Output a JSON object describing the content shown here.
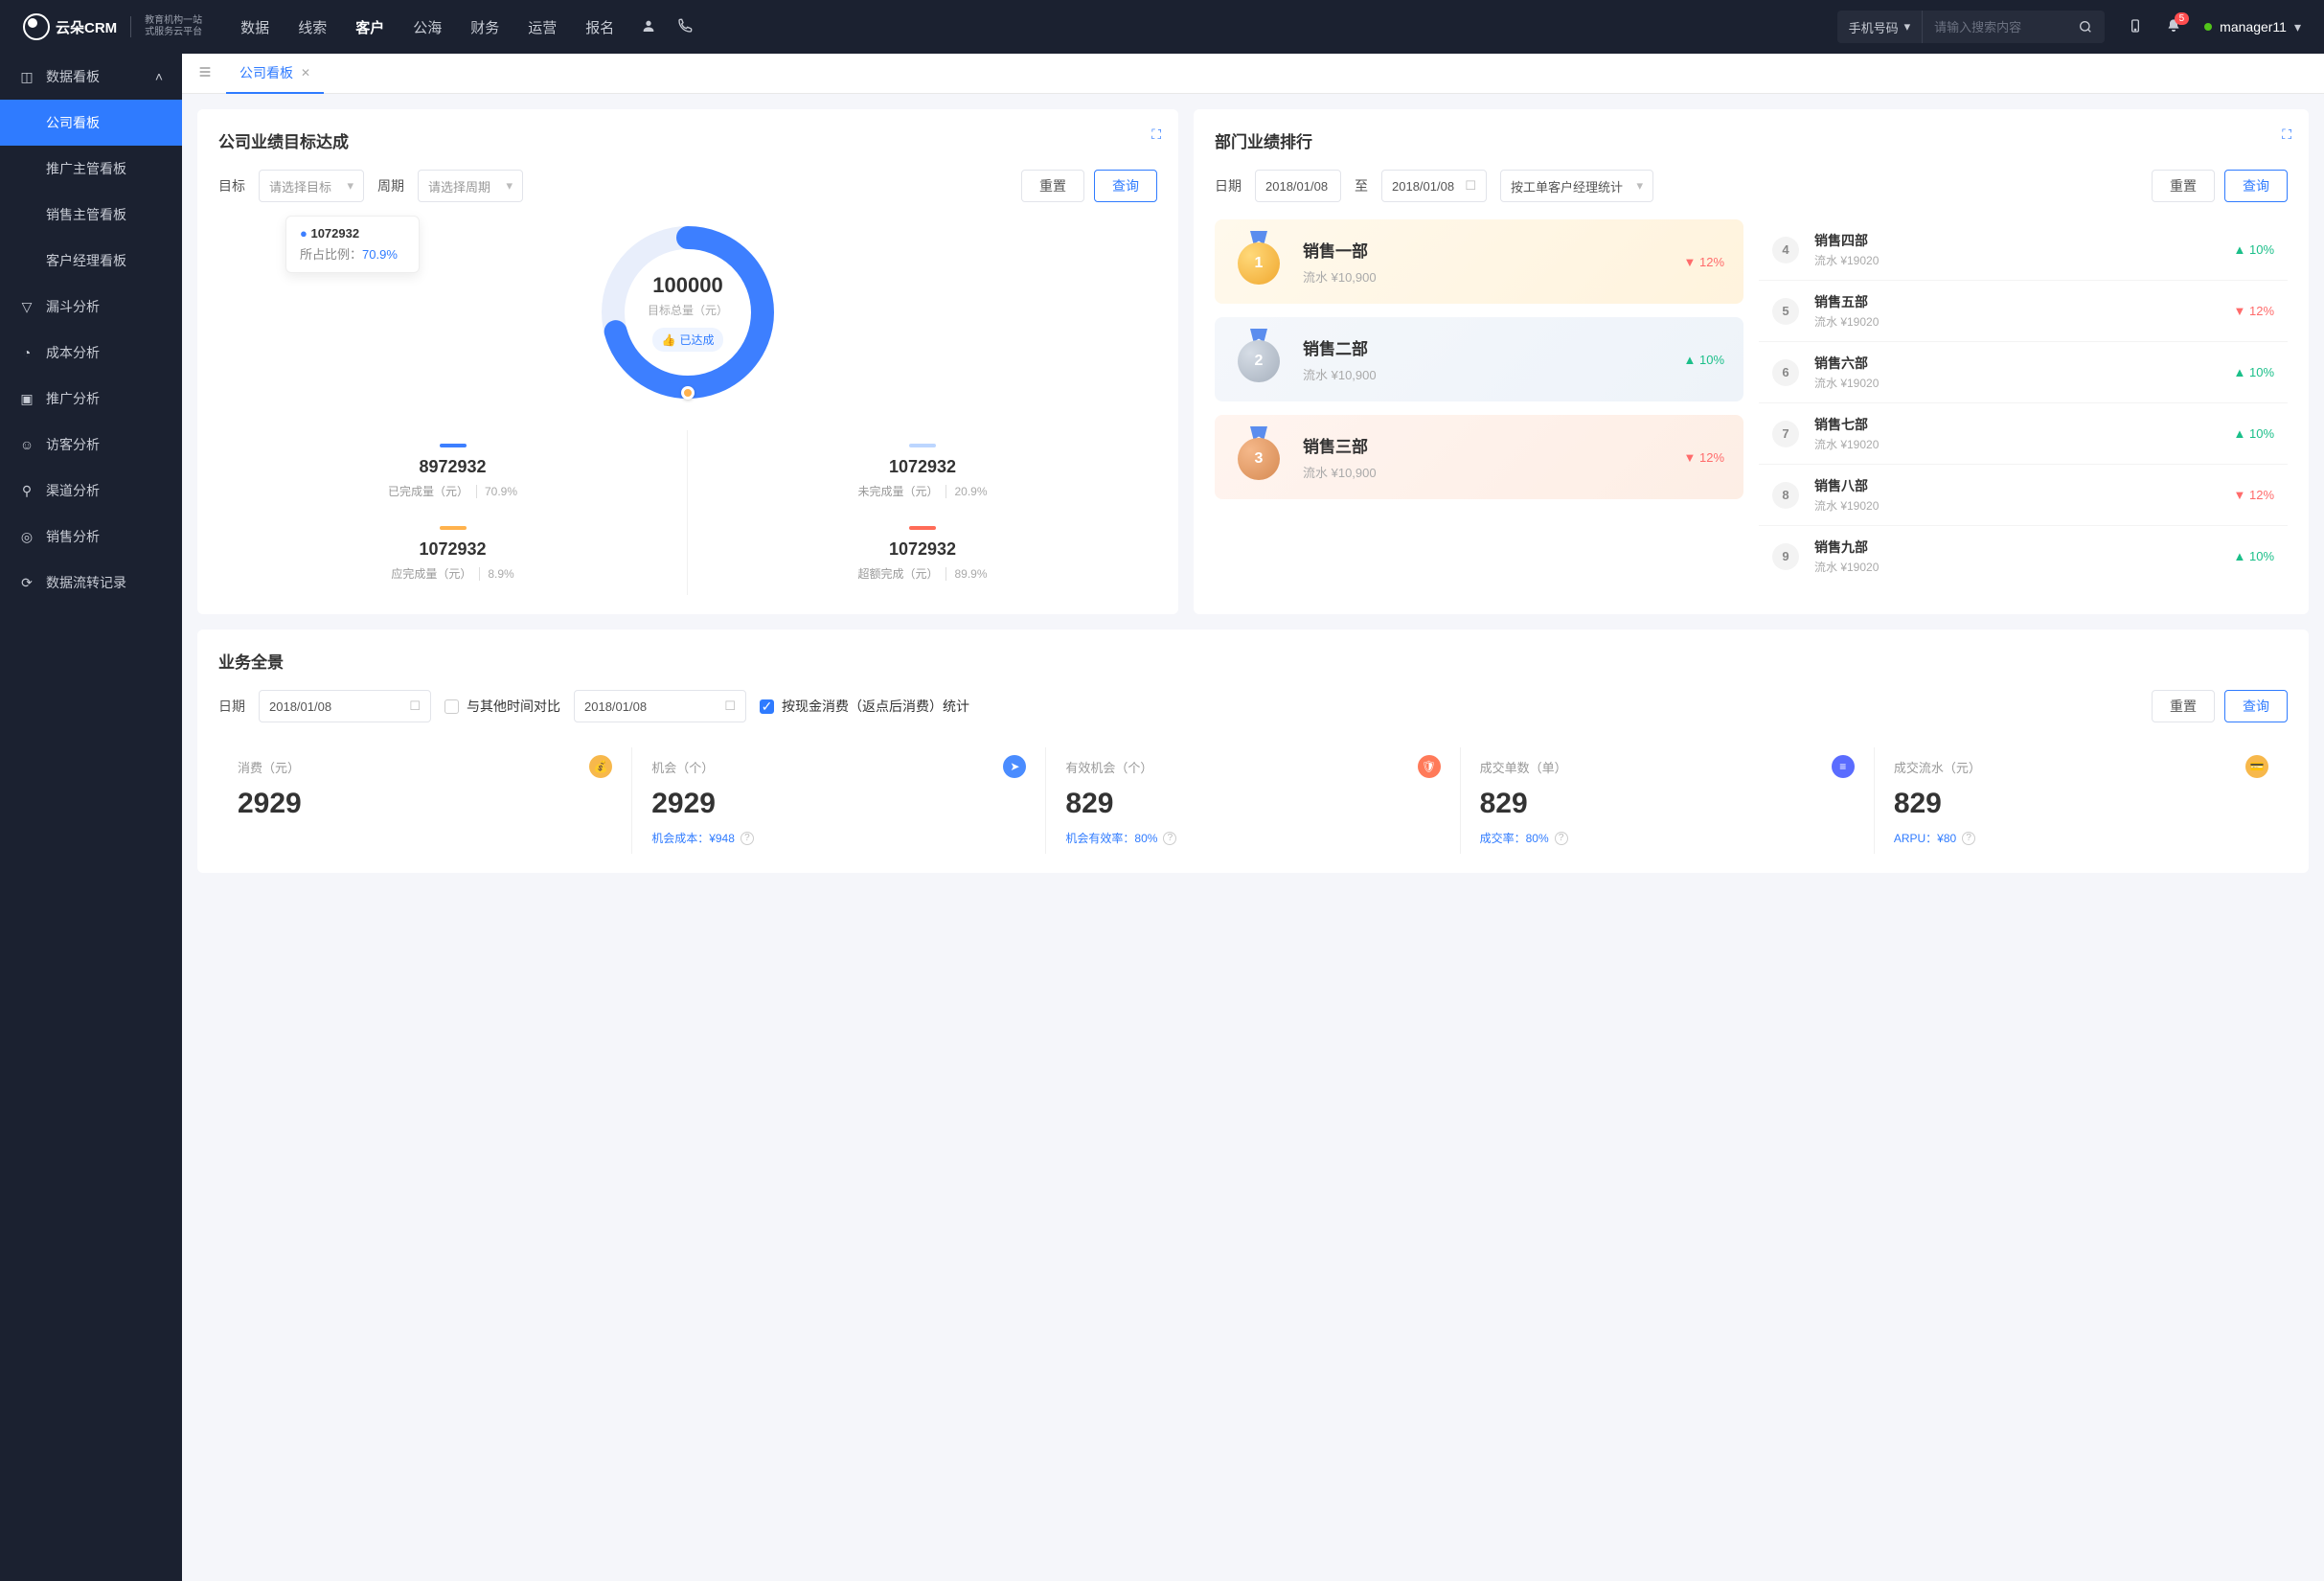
{
  "brand": {
    "name": "云朵CRM",
    "sub1": "教育机构一站",
    "sub2": "式服务云平台"
  },
  "topnav": {
    "items": [
      "数据",
      "线索",
      "客户",
      "公海",
      "财务",
      "运营",
      "报名"
    ],
    "active": "客户",
    "search_type": "手机号码",
    "search_placeholder": "请输入搜索内容",
    "notif_count": "5",
    "user": "manager11"
  },
  "sidebar": {
    "items": [
      {
        "label": "数据看板",
        "expanded": true,
        "children": [
          {
            "label": "公司看板",
            "active": true
          },
          {
            "label": "推广主管看板"
          },
          {
            "label": "销售主管看板"
          },
          {
            "label": "客户经理看板"
          }
        ]
      },
      {
        "label": "漏斗分析"
      },
      {
        "label": "成本分析"
      },
      {
        "label": "推广分析"
      },
      {
        "label": "访客分析"
      },
      {
        "label": "渠道分析"
      },
      {
        "label": "销售分析"
      },
      {
        "label": "数据流转记录"
      }
    ]
  },
  "tabs": {
    "active": "公司看板"
  },
  "panel_target": {
    "title": "公司业绩目标达成",
    "target_label": "目标",
    "target_placeholder": "请选择目标",
    "period_label": "周期",
    "period_placeholder": "请选择周期",
    "reset": "重置",
    "query": "查询",
    "donut": {
      "total": "100000",
      "total_label": "目标总量（元）",
      "badge": "已达成",
      "tooltip_value": "1072932",
      "tooltip_label": "所占比例：",
      "tooltip_pct": "70.9%"
    },
    "stats": [
      {
        "bar_color": "#3d7fff",
        "value": "8972932",
        "label": "已完成量（元）",
        "pct": "70.9%"
      },
      {
        "bar_color": "#bcd6ff",
        "value": "1072932",
        "label": "未完成量（元）",
        "pct": "20.9%"
      },
      {
        "bar_color": "#ffb24d",
        "value": "1072932",
        "label": "应完成量（元）",
        "pct": "8.9%"
      },
      {
        "bar_color": "#ff6b57",
        "value": "1072932",
        "label": "超额完成（元）",
        "pct": "89.9%"
      }
    ]
  },
  "panel_rank": {
    "title": "部门业绩排行",
    "date_label": "日期",
    "date_from": "2018/01/08",
    "date_to_label": "至",
    "date_to": "2018/01/08",
    "group_by": "按工单客户经理统计",
    "reset": "重置",
    "query": "查询",
    "top3": [
      {
        "rank": "1",
        "name": "销售一部",
        "flow_label": "流水",
        "flow": "¥10,900",
        "dir": "down",
        "pct": "12%"
      },
      {
        "rank": "2",
        "name": "销售二部",
        "flow_label": "流水",
        "flow": "¥10,900",
        "dir": "up",
        "pct": "10%"
      },
      {
        "rank": "3",
        "name": "销售三部",
        "flow_label": "流水",
        "flow": "¥10,900",
        "dir": "down",
        "pct": "12%"
      }
    ],
    "rest": [
      {
        "rank": "4",
        "name": "销售四部",
        "flow": "流水 ¥19020",
        "dir": "up",
        "pct": "10%"
      },
      {
        "rank": "5",
        "name": "销售五部",
        "flow": "流水 ¥19020",
        "dir": "down",
        "pct": "12%"
      },
      {
        "rank": "6",
        "name": "销售六部",
        "flow": "流水 ¥19020",
        "dir": "up",
        "pct": "10%"
      },
      {
        "rank": "7",
        "name": "销售七部",
        "flow": "流水 ¥19020",
        "dir": "up",
        "pct": "10%"
      },
      {
        "rank": "8",
        "name": "销售八部",
        "flow": "流水 ¥19020",
        "dir": "down",
        "pct": "12%"
      },
      {
        "rank": "9",
        "name": "销售九部",
        "flow": "流水 ¥19020",
        "dir": "up",
        "pct": "10%"
      }
    ]
  },
  "panel_overview": {
    "title": "业务全景",
    "date_label": "日期",
    "date1": "2018/01/08",
    "compare_label": "与其他时间对比",
    "date2": "2018/01/08",
    "cash_stat_label": "按现金消费（返点后消费）统计",
    "reset": "重置",
    "query": "查询",
    "metrics": [
      {
        "title": "消费（元）",
        "value": "2929",
        "footer": "",
        "icon_bg": "#f7b84b"
      },
      {
        "title": "机会（个）",
        "value": "2929",
        "footer": "机会成本：¥948",
        "icon_bg": "#4a8cff"
      },
      {
        "title": "有效机会（个）",
        "value": "829",
        "footer": "机会有效率：80%",
        "icon_bg": "#ff7a59"
      },
      {
        "title": "成交单数（单）",
        "value": "829",
        "footer": "成交率：80%",
        "icon_bg": "#5a6cff"
      },
      {
        "title": "成交流水（元）",
        "value": "829",
        "footer": "ARPU：¥80",
        "icon_bg": "#f7b84b"
      }
    ]
  },
  "chart_data": {
    "type": "pie",
    "title": "公司业绩目标达成",
    "total_label": "目标总量（元）",
    "total": 100000,
    "series": [
      {
        "name": "已完成量（元）",
        "value": 8972932,
        "pct": 70.9,
        "color": "#3d7fff"
      },
      {
        "name": "未完成量（元）",
        "value": 1072932,
        "pct": 20.9,
        "color": "#bcd6ff"
      },
      {
        "name": "应完成量（元）",
        "value": 1072932,
        "pct": 8.9,
        "color": "#ffb24d"
      },
      {
        "name": "超额完成（元）",
        "value": 1072932,
        "pct": 89.9,
        "color": "#ff6b57"
      }
    ],
    "highlight": {
      "name": "已完成",
      "value": 1072932,
      "pct": 70.9
    }
  }
}
